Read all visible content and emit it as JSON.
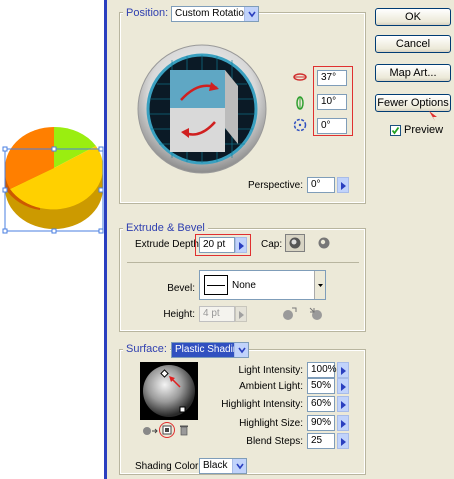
{
  "position": {
    "legend": "Position:",
    "preset": "Custom Rotation",
    "x_rotation": "37°",
    "y_rotation": "10°",
    "z_rotation": "0°",
    "perspective_label": "Perspective:",
    "perspective_value": "0°"
  },
  "extrude": {
    "legend": "Extrude & Bevel",
    "depth_label": "Extrude Depth:",
    "depth_value": "20 pt",
    "cap_label": "Cap:",
    "bevel_label": "Bevel:",
    "bevel_value": "None",
    "height_label": "Height:",
    "height_value": "4 pt"
  },
  "surface": {
    "legend": "Surface:",
    "preset": "Plastic Shading",
    "rows": [
      {
        "label": "Light Intensity:",
        "value": "100%"
      },
      {
        "label": "Ambient Light:",
        "value": "50%"
      },
      {
        "label": "Highlight Intensity:",
        "value": "60%"
      },
      {
        "label": "Highlight Size:",
        "value": "90%"
      },
      {
        "label": "Blend Steps:",
        "value": "25"
      }
    ],
    "shading_color_label": "Shading Color:",
    "shading_color_value": "Black"
  },
  "buttons": {
    "ok": "OK",
    "cancel": "Cancel",
    "map_art": "Map Art...",
    "fewer_options": "Fewer Options"
  },
  "preview": {
    "label": "Preview",
    "checked": true
  },
  "colors": {
    "accent": "#2a3fbf",
    "dialog_bg": "#ece9d8",
    "highlight_red": "#e03030",
    "pie_orange": "#ff8000",
    "pie_green": "#99ff00",
    "pie_yellow": "#ffd700"
  }
}
